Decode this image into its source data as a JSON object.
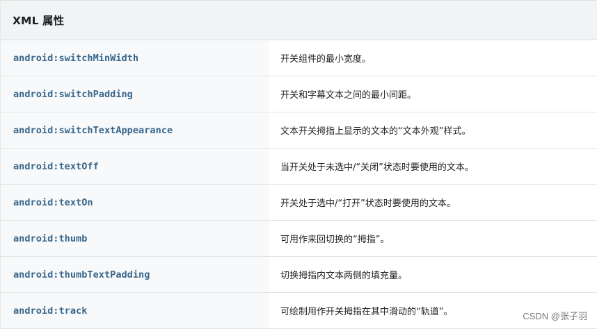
{
  "table": {
    "header": "XML 属性",
    "rows": [
      {
        "attribute": "android:switchMinWidth",
        "description": "开关组件的最小宽度。"
      },
      {
        "attribute": "android:switchPadding",
        "description": "开关和字幕文本之间的最小间距。"
      },
      {
        "attribute": "android:switchTextAppearance",
        "description": "文本开关拇指上显示的文本的“文本外观”样式。"
      },
      {
        "attribute": "android:textOff",
        "description": "当开关处于未选中/“关闭”状态时要使用的文本。"
      },
      {
        "attribute": "android:textOn",
        "description": "开关处于选中/“打开”状态时要使用的文本。"
      },
      {
        "attribute": "android:thumb",
        "description": "可用作来回切换的“拇指”。"
      },
      {
        "attribute": "android:thumbTextPadding",
        "description": "切换拇指内文本两侧的填充量。"
      },
      {
        "attribute": "android:track",
        "description": "可绘制用作开关拇指在其中滑动的“轨道”。"
      }
    ]
  },
  "watermark": "CSDN @张子羽",
  "colors": {
    "attribute_text": "#37668c",
    "header_bg": "#f1f3f4",
    "attribute_cell_bg": "#f8f9fa"
  }
}
